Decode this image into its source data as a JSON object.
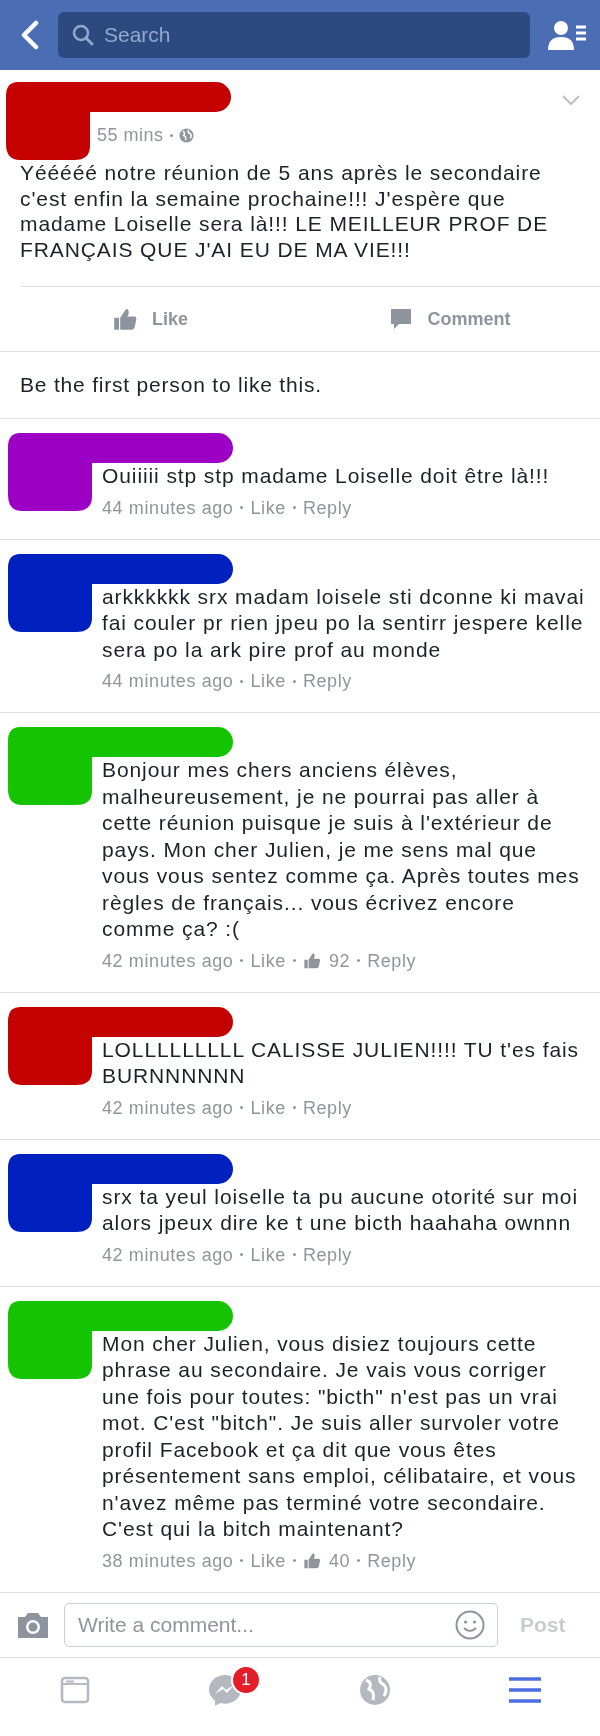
{
  "header": {
    "search": {
      "placeholder": "Search"
    }
  },
  "post": {
    "color": "#c40000",
    "time": "55 mins",
    "text": "Yééééé notre réunion de 5 ans après le secondaire c'est enfin la semaine prochaine!!! J'espère que madame Loiselle sera là!!! LE MEILLEUR PROF DE FRANÇAIS QUE J'AI EU DE MA VIE!!!",
    "actions": [
      "Like",
      "Comment"
    ],
    "likes_summary": "Be the first person to like this."
  },
  "comments": [
    {
      "color": "#9c00c4",
      "text": "Ouiiiii stp stp madame Loiselle doit être là!!!",
      "time": "44 minutes ago",
      "like": "Like",
      "reply": "Reply"
    },
    {
      "color": "#0020c0",
      "text": "arkkkkkk srx madam loisele sti dconne ki mavai fai couler pr rien jpeu po la sentirr jespere kelle sera po la ark pire prof au monde",
      "time": "44 minutes ago",
      "like": "Like",
      "reply": "Reply"
    },
    {
      "color": "#14c400",
      "text": "Bonjour mes chers anciens élèves, malheureusement, je ne pourrai pas aller à cette réunion puisque je suis à l'extérieur de pays. Mon cher Julien, je me sens mal que vous vous sentez comme ça. Après toutes mes règles de français... vous écrivez encore comme ça? :(",
      "time": "42 minutes ago",
      "like": "Like",
      "likes": "92",
      "reply": "Reply"
    },
    {
      "color": "#c40000",
      "text": "LOLLLLLLLLL CALISSE JULIEN!!!! TU t'es fais BURNNNNNN",
      "time": "42 minutes ago",
      "like": "Like",
      "reply": "Reply"
    },
    {
      "color": "#0020c0",
      "text": "srx ta yeul loiselle ta pu aucune otorité sur moi alors jpeux dire ke t une bicth haahaha ownnn",
      "time": "42 minutes ago",
      "like": "Like",
      "reply": "Reply"
    },
    {
      "color": "#14c400",
      "text": "Mon cher Julien, vous disiez toujours cette phrase au secondaire. Je vais vous corriger une fois pour toutes: \"bicth\" n'est pas un vrai mot. C'est \"bitch\". Je suis aller survoler votre profil Facebook et ça dit que vous êtes présentement sans emploi, célibataire, et vous n'avez même pas terminé votre secondaire. C'est qui la bitch maintenant?",
      "time": "38 minutes ago",
      "like": "Like",
      "likes": "40",
      "reply": "Reply"
    }
  ],
  "composer": {
    "placeholder": "Write a comment...",
    "post": "Post",
    "post_disabled": true
  },
  "tabs": [
    {
      "kind": "feed",
      "selected": false
    },
    {
      "kind": "messages",
      "selected": false,
      "badge": "1"
    },
    {
      "kind": "globe",
      "selected": false
    },
    {
      "kind": "menu",
      "selected": true
    }
  ]
}
